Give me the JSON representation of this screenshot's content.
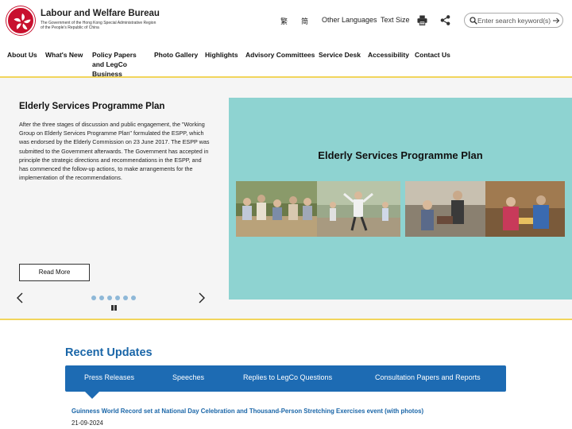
{
  "header": {
    "title": "Labour and Welfare Bureau",
    "subtitle": "The Government of the Hong Kong Special Administrative Region of the People's Republic of China",
    "lang_traditional": "繁",
    "lang_simplified": "简",
    "other_languages": "Other Languages",
    "text_size": "Text Size",
    "print_icon": "print-icon",
    "share_icon": "share-icon",
    "search": {
      "placeholder": "Enter search keyword(s)"
    }
  },
  "nav": {
    "items": [
      {
        "label": "About Us"
      },
      {
        "label": "What's New"
      },
      {
        "label": "Policy Papers and LegCo Business"
      },
      {
        "label": "Photo Gallery"
      },
      {
        "label": "Highlights"
      },
      {
        "label": "Advisory Committees"
      },
      {
        "label": "Service Desk"
      },
      {
        "label": "Accessibility"
      },
      {
        "label": "Contact Us"
      }
    ]
  },
  "banner": {
    "title": "Elderly Services Programme Plan",
    "text": "After the three stages of discussion and public engagement, the \"Working Group on Elderly Services Programme Plan\" formulated the ESPP, which was endorsed by the Elderly Commission on 23 June 2017. The ESPP was submitted to the Government afterwards. The Government has accepted in principle the strategic directions and recommendations in the ESPP, and has commenced the follow-up actions, to make arrangements for the implementation of the recommendations.",
    "read_more": "Read More",
    "image_title": "Elderly Services Programme Plan",
    "slide_count": 6,
    "accent_color": "#f2d55c",
    "image_bg": "#8ed3d1"
  },
  "recent": {
    "title": "Recent Updates",
    "tabs": [
      {
        "label": "Press Releases"
      },
      {
        "label": "Speeches"
      },
      {
        "label": "Replies to LegCo Questions"
      },
      {
        "label": "Consultation Papers and Reports"
      }
    ],
    "items": [
      {
        "title": "Guinness World Record set at National Day Celebration and Thousand-Person Stretching Exercises event (with photos)",
        "date": "21-09-2024"
      }
    ],
    "tab_color": "#1d6bb3"
  }
}
